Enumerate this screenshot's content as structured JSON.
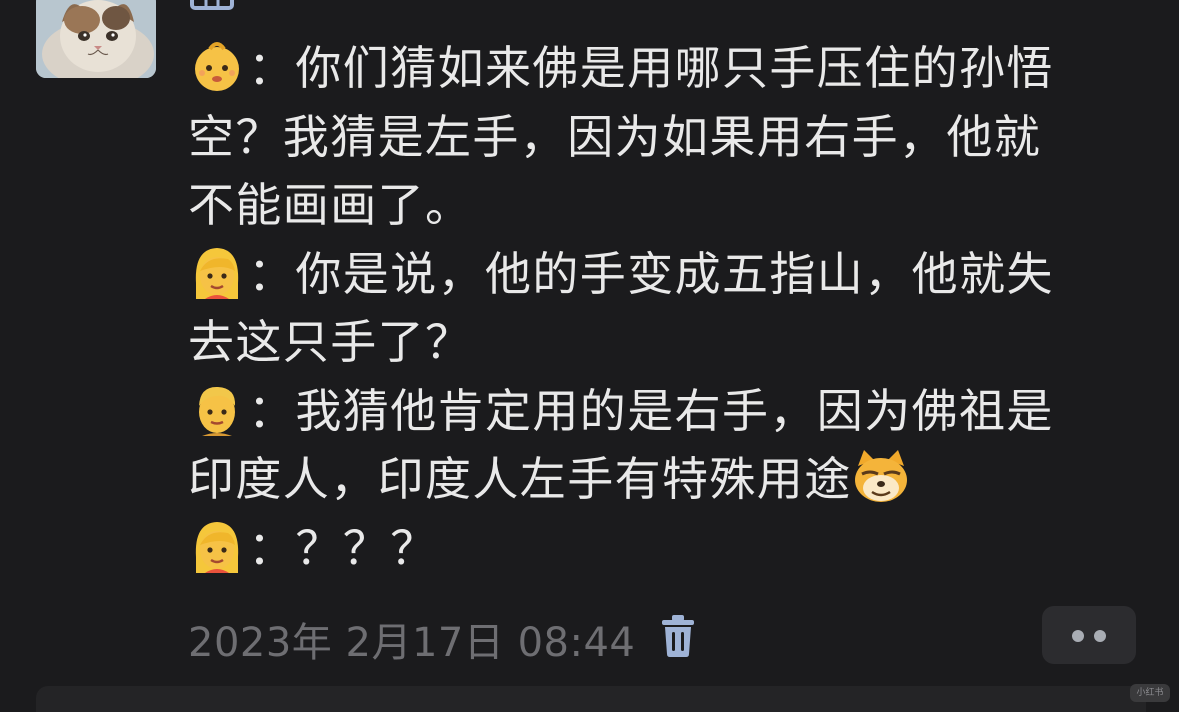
{
  "message": {
    "lines": [
      {
        "emoji": "baby-emoji",
        "text": "：你们猜如来佛是用哪只手压住的孙悟"
      },
      {
        "text": "空？我猜是左手，因为如果用右手，他就"
      },
      {
        "text": "不能画画了。"
      },
      {
        "emoji": "blonde-woman-emoji",
        "text": "：你是说，他的手变成五指山，他就失"
      },
      {
        "text": "去这只手了？"
      },
      {
        "emoji": "blonde-man-emoji",
        "text": "：我猜他肯定用的是右手，因为佛祖是"
      },
      {
        "text": "印度人，印度人左手有特殊用途",
        "trailing_emoji": "doge-cat-emoji"
      },
      {
        "emoji": "blonde-woman-emoji",
        "text": "：？？？"
      }
    ]
  },
  "footer": {
    "timestamp": "2023年 2月17日 08:44",
    "trash_icon": "trash-icon",
    "more_icon": "more-dots-icon"
  },
  "watermark": "小红书",
  "colors": {
    "background": "#1b1b1d",
    "text": "#e9e9e9",
    "timestamp": "#6e6e72",
    "accent_icon": "#9fb3d6"
  }
}
